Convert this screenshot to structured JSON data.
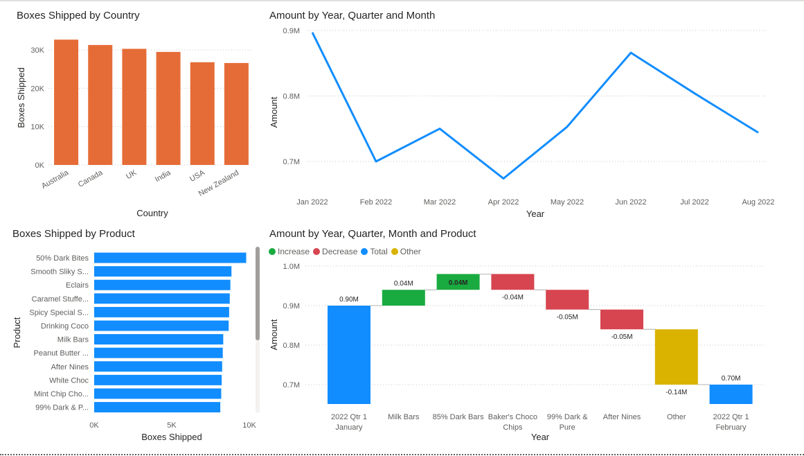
{
  "titles": {
    "country": "Boxes Shipped by Country",
    "line": "Amount by Year, Quarter and Month",
    "product": "Boxes Shipped by Product",
    "waterfall": "Amount by Year, Quarter, Month and Product"
  },
  "legend": {
    "increase": "Increase",
    "decrease": "Decrease",
    "total": "Total",
    "other": "Other"
  },
  "colors": {
    "orange": "#E66C37",
    "blue": "#118DFF",
    "green": "#1AAB40",
    "red": "#D64550",
    "gold": "#D9B300"
  },
  "chart_data": [
    {
      "id": "country",
      "type": "bar",
      "title": "Boxes Shipped by Country",
      "xlabel": "Country",
      "ylabel": "Boxes Shipped",
      "categories": [
        "Australia",
        "Canada",
        "UK",
        "India",
        "USA",
        "New Zealand"
      ],
      "values": [
        32700,
        31300,
        30300,
        29500,
        26800,
        26600
      ],
      "ylim": [
        0,
        34000
      ],
      "yticks": [
        0,
        10000,
        20000,
        30000
      ],
      "ytick_labels": [
        "0K",
        "10K",
        "20K",
        "30K"
      ],
      "grid": true
    },
    {
      "id": "line",
      "type": "line",
      "title": "Amount by Year, Quarter and Month",
      "xlabel": "Year",
      "ylabel": "Amount",
      "x": [
        "Jan 2022",
        "Feb 2022",
        "Mar 2022",
        "Apr 2022",
        "May 2022",
        "Jun 2022",
        "Jul 2022",
        "Aug 2022"
      ],
      "values": [
        0.897,
        0.7,
        0.75,
        0.674,
        0.753,
        0.866,
        0.804,
        0.744
      ],
      "ylim": [
        0.66,
        0.9
      ],
      "yticks": [
        0.7,
        0.8,
        0.9
      ],
      "ytick_labels": [
        "0.7M",
        "0.8M",
        "0.9M"
      ],
      "grid": true
    },
    {
      "id": "product",
      "type": "bar",
      "orientation": "horizontal",
      "title": "Boxes Shipped by Product",
      "xlabel": "Boxes Shipped",
      "ylabel": "Product",
      "categories": [
        "50% Dark Bites",
        "Smooth Sliky S...",
        "Eclairs",
        "Caramel Stuffe...",
        "Spicy Special S...",
        "Drinking Coco",
        "Milk Bars",
        "Peanut Butter ...",
        "After Nines",
        "White Choc",
        "Mint Chip Cho...",
        "99% Dark & P..."
      ],
      "values": [
        9800,
        8850,
        8780,
        8740,
        8700,
        8670,
        8320,
        8290,
        8250,
        8220,
        8190,
        8130
      ],
      "xlim": [
        0,
        10000
      ],
      "xticks": [
        0,
        5000,
        10000
      ],
      "xtick_labels": [
        "0K",
        "5K",
        "10K"
      ]
    },
    {
      "id": "waterfall",
      "type": "bar",
      "subtype": "waterfall",
      "title": "Amount by Year, Quarter, Month and Product",
      "xlabel": "Year",
      "ylabel": "Amount",
      "categories": [
        "2022 Qtr 1 January",
        "Milk Bars",
        "85% Dark Bars",
        "Baker's Choco Chips",
        "99% Dark & Pure",
        "After Nines",
        "Other",
        "2022 Qtr 1 February"
      ],
      "category_lines": [
        [
          "2022 Qtr 1",
          "January"
        ],
        [
          "Milk Bars"
        ],
        [
          "85% Dark Bars"
        ],
        [
          "Baker's Choco",
          "Chips"
        ],
        [
          "99% Dark &",
          "Pure"
        ],
        [
          "After Nines"
        ],
        [
          "Other"
        ],
        [
          "2022 Qtr 1",
          "February"
        ]
      ],
      "kinds": [
        "total",
        "increase",
        "increase",
        "decrease",
        "decrease",
        "decrease",
        "other",
        "total"
      ],
      "values": [
        0.9,
        0.04,
        0.04,
        -0.04,
        -0.05,
        -0.05,
        -0.14,
        0.7
      ],
      "labels": [
        "0.90M",
        "0.04M",
        "0.04M",
        "-0.04M",
        "-0.05M",
        "-0.05M",
        "-0.14M",
        "0.70M"
      ],
      "ylim": [
        0.65,
        1.0
      ],
      "yticks": [
        0.7,
        0.8,
        0.9,
        1.0
      ],
      "ytick_labels": [
        "0.7M",
        "0.8M",
        "0.9M",
        "1.0M"
      ],
      "grid": true
    }
  ]
}
